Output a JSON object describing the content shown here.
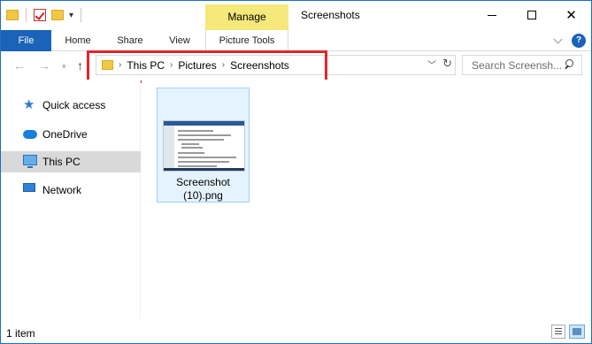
{
  "window": {
    "title": "Screenshots",
    "contextual_group": "Manage"
  },
  "ribbon": {
    "tabs": [
      {
        "label": "File"
      },
      {
        "label": "Home"
      },
      {
        "label": "Share"
      },
      {
        "label": "View"
      },
      {
        "label": "Picture Tools"
      }
    ],
    "help_label": "?"
  },
  "address": {
    "breadcrumbs": [
      "This PC",
      "Pictures",
      "Screenshots"
    ]
  },
  "search": {
    "placeholder": "Search Screensh..."
  },
  "sidebar": {
    "items": [
      {
        "label": "Quick access",
        "icon": "star-icon"
      },
      {
        "label": "OneDrive",
        "icon": "cloud-icon"
      },
      {
        "label": "This PC",
        "icon": "computer-icon",
        "selected": true
      },
      {
        "label": "Network",
        "icon": "network-icon"
      }
    ]
  },
  "files": [
    {
      "name_line1": "Screenshot",
      "name_line2": "(10).png",
      "type": "png"
    }
  ],
  "status": {
    "item_count": "1 item"
  },
  "colors": {
    "accent": "#1a63b8",
    "manage_tab": "#f6e87a",
    "highlight_box": "#e0262f",
    "selection": "#e5f3ff"
  }
}
